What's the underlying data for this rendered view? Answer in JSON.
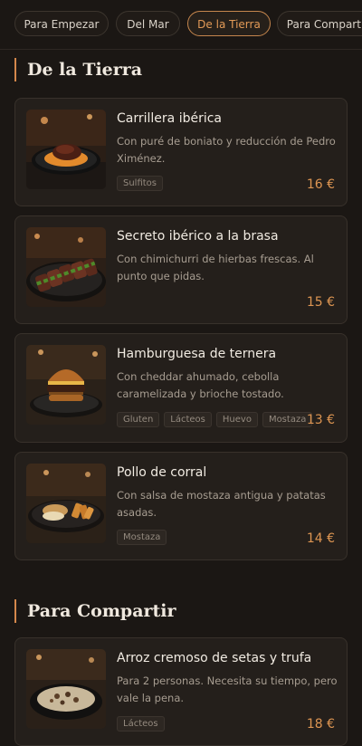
{
  "tabs": [
    {
      "label": "Para Empezar",
      "active": false
    },
    {
      "label": "Del Mar",
      "active": false
    },
    {
      "label": "De la Tierra",
      "active": true
    },
    {
      "label": "Para Compartir",
      "active": false
    }
  ],
  "sections": [
    {
      "title": "De la Tierra",
      "dishes": [
        {
          "name": "Carrillera ibérica",
          "description": "Con puré de boniato y reducción de Pedro Ximénez.",
          "tags": [
            "Sulfitos"
          ],
          "price": "16 €",
          "image": "braised-cheek-plate-image"
        },
        {
          "name": "Secreto ibérico a la brasa",
          "description": "Con chimichurri de hierbas frescas. Al punto que pidas.",
          "tags": [],
          "price": "15 €",
          "image": "sliced-pork-plate-image"
        },
        {
          "name": "Hamburguesa de ternera",
          "description": "Con cheddar ahumado, cebolla caramelizada y brioche tostado.",
          "tags": [
            "Gluten",
            "Lácteos",
            "Huevo",
            "Mostaza"
          ],
          "price": "13 €",
          "image": "burger-plate-image"
        },
        {
          "name": "Pollo de corral",
          "description": "Con salsa de mostaza antigua y patatas asadas.",
          "tags": [
            "Mostaza"
          ],
          "price": "14 €",
          "image": "chicken-potatoes-plate-image"
        }
      ]
    },
    {
      "title": "Para Compartir",
      "dishes": [
        {
          "name": "Arroz cremoso de setas y trufa",
          "description": "Para 2 personas. Necesita su tiempo, pero vale la pena.",
          "tags": [
            "Lácteos"
          ],
          "price": "18 €",
          "image": "mushroom-rice-pan-image"
        }
      ]
    }
  ],
  "colors": {
    "accent": "#e39a57",
    "background": "#1b1714",
    "card": "#241f1b"
  }
}
